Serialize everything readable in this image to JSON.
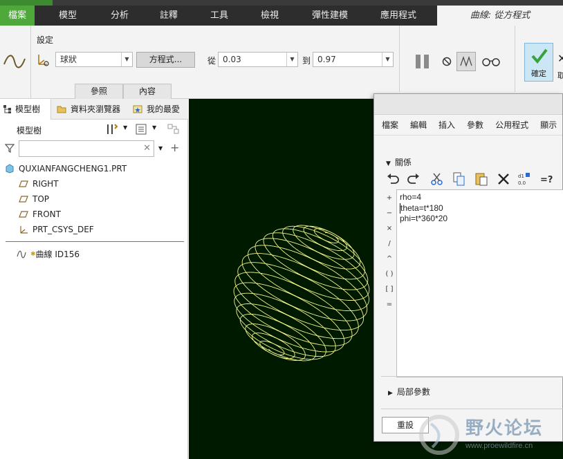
{
  "ribbon": {
    "tabs": [
      "檔案",
      "模型",
      "分析",
      "註釋",
      "工具",
      "檢視",
      "彈性建模",
      "應用程式"
    ],
    "active_tab": "曲線: 從方程式"
  },
  "dashboard": {
    "setting_label": "設定",
    "coord_type": "球狀",
    "equation_button": "方程式...",
    "from_label": "從",
    "from_value": "0.03",
    "to_label": "到",
    "to_value": "0.97",
    "subtabs": [
      "參照",
      "內容"
    ],
    "confirm_label": "確定",
    "cancel_label_partial": "取"
  },
  "left_panel": {
    "tabs": [
      "模型樹",
      "資料夾瀏覽器",
      "我的最愛"
    ],
    "tree_title": "模型樹",
    "search_placeholder": "",
    "root": "QUXIANFANGCHENG1.PRT",
    "items": [
      "RIGHT",
      "TOP",
      "FRONT",
      "PRT_CSYS_DEF"
    ],
    "feature": "曲線 ID156"
  },
  "dialog": {
    "menu": [
      "檔案",
      "編輯",
      "插入",
      "參數",
      "公用程式",
      "顯示"
    ],
    "relations_section": "關係",
    "operators": [
      "+",
      "−",
      "×",
      "/",
      "^",
      "( )",
      "[ ]",
      "="
    ],
    "equations": [
      "rho=4",
      "theta=t*180",
      "phi=t*360*20"
    ],
    "local_params": "局部參數",
    "reset_button": "重設"
  },
  "watermark": {
    "title": "野火论坛",
    "url": "www.proewildfire.cn"
  },
  "colors": {
    "file_tab": "#4ea83a",
    "ribbon_bg": "#2d2d2d",
    "graphics_bg": "#001a00",
    "curve": "#f4f48a",
    "confirm_bg": "#cbe6f5"
  }
}
